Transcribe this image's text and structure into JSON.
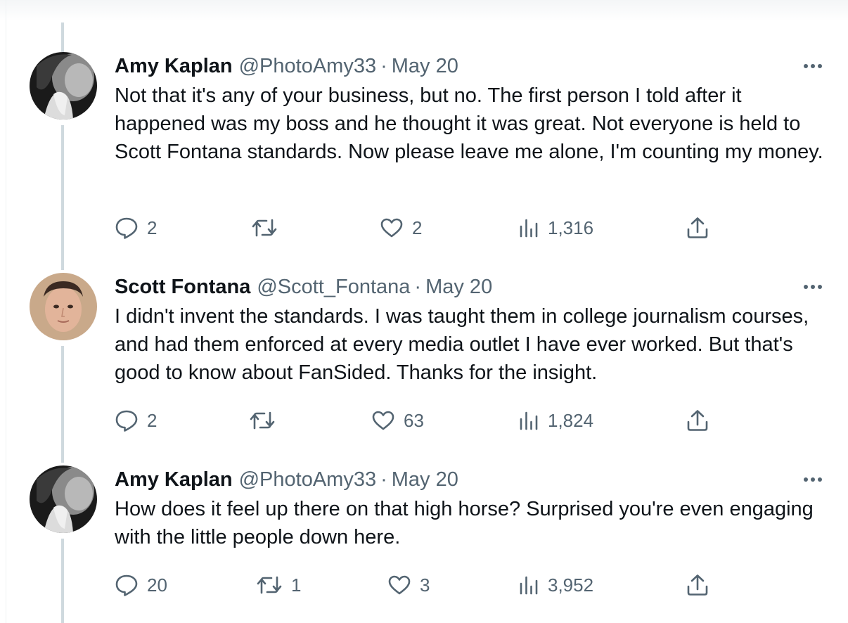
{
  "tweets": [
    {
      "author": "Amy Kaplan",
      "handle": "@PhotoAmy33",
      "separator": "·",
      "date": "May 20",
      "text": "Not that it's any of your business, but no. The first person I told after it happened was my boss and he thought it was great. Not everyone is held to Scott Fontana standards. Now please leave me alone, I'm counting my money.",
      "avatar": "amy-kaplan-avatar",
      "replies": "2",
      "retweets": "",
      "likes": "2",
      "views": "1,316"
    },
    {
      "author": "Scott Fontana",
      "handle": "@Scott_Fontana",
      "separator": "·",
      "date": "May 20",
      "text": "I didn't invent the standards. I was taught them in college journalism courses, and had them enforced at every media outlet I have ever worked. But that's good to know about FanSided. Thanks for the insight.",
      "avatar": "scott-fontana-avatar",
      "replies": "2",
      "retweets": "",
      "likes": "63",
      "views": "1,824"
    },
    {
      "author": "Amy Kaplan",
      "handle": "@PhotoAmy33",
      "separator": "·",
      "date": "May 20",
      "text": "How does it feel up there on that high horse? Surprised you're even engaging with the little people down here.",
      "avatar": "amy-kaplan-avatar",
      "replies": "20",
      "retweets": "1",
      "likes": "3",
      "views": "3,952"
    }
  ],
  "icons": {
    "more": "more-horizontal-icon",
    "reply": "reply-bubble-icon",
    "retweet": "retweet-icon",
    "like": "heart-icon",
    "views": "views-bar-chart-icon",
    "share": "share-upload-icon"
  },
  "colors": {
    "text": "#0f1419",
    "secondary": "#536471",
    "thread_line": "#cfd9de"
  }
}
